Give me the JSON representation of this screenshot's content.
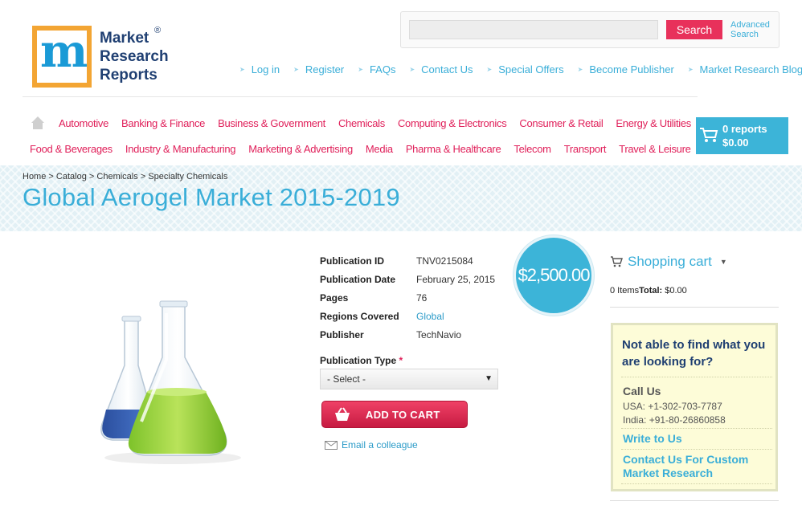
{
  "logo": {
    "line1": "Market",
    "line2": "Research",
    "line3": "Reports",
    "reg": "®",
    "letter": "m"
  },
  "search": {
    "placeholder": "",
    "button": "Search",
    "advanced": "Advanced Search"
  },
  "toplinks": [
    "Log in",
    "Register",
    "FAQs",
    "Contact Us",
    "Special Offers",
    "Become Publisher",
    "Market Research Blog"
  ],
  "nav": {
    "row1": [
      "Automotive",
      "Banking & Finance",
      "Business & Government",
      "Chemicals",
      "Computing & Electronics",
      "Consumer & Retail",
      "Energy & Utilities"
    ],
    "row2": [
      "Food & Beverages",
      "Industry & Manufacturing",
      "Marketing & Advertising",
      "Media",
      "Pharma & Healthcare",
      "Telecom",
      "Transport",
      "Travel & Leisure"
    ]
  },
  "cart": {
    "reports": "0 reports",
    "total": "$0.00"
  },
  "breadcrumb": {
    "home": "Home",
    "catalog": "Catalog",
    "chemicals": "Chemicals",
    "current": "Specialty Chemicals",
    "sep": ">"
  },
  "title": "Global Aerogel Market 2015-2019",
  "details": [
    {
      "label": "Publication ID",
      "value": "TNV0215084"
    },
    {
      "label": "Publication Date",
      "value": "February 25, 2015"
    },
    {
      "label": "Pages",
      "value": "76"
    },
    {
      "label": "Regions Covered",
      "value": "Global"
    },
    {
      "label": "Publisher",
      "value": "TechNavio"
    }
  ],
  "price": "$2,500.00",
  "publication_type": {
    "label": "Publication Type",
    "required": "*",
    "selected": "- Select -"
  },
  "add_to_cart": "ADD TO CART",
  "email_colleague": "Email a colleague",
  "shopping_cart": {
    "title": "Shopping cart",
    "items": "0 Items",
    "total_label": "Total:",
    "total_value": "$0.00"
  },
  "help": {
    "title": "Not able to find what you are looking for?",
    "call": "Call Us",
    "usa": "USA: +1-302-703-7787",
    "india": "India: +91-80-26860858",
    "write": "Write to Us",
    "custom": "Contact Us For Custom Market Research"
  },
  "colors": {
    "accent": "#3aaed8",
    "nav": "#e0205a",
    "logo_orange": "#f3a533",
    "logo_blue": "#1f3f72"
  }
}
